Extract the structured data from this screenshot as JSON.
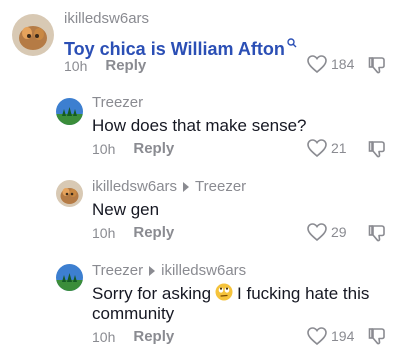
{
  "comments": [
    {
      "username": "ikilledsw6ars",
      "text": "Toy chica is William Afton",
      "time": "10h",
      "reply_label": "Reply",
      "likes": "184"
    },
    {
      "username": "Treezer",
      "text": "How does that make sense?",
      "time": "10h",
      "reply_label": "Reply",
      "likes": "21"
    },
    {
      "username": "ikilledsw6ars",
      "reply_to": "Treezer",
      "text": "New gen",
      "time": "10h",
      "reply_label": "Reply",
      "likes": "29"
    },
    {
      "username": "Treezer",
      "reply_to": "ikilledsw6ars",
      "text_part1": "Sorry for asking",
      "text_part2": "I fucking hate this",
      "text_line2": "community",
      "time": "10h",
      "reply_label": "Reply",
      "likes": "194"
    }
  ],
  "colors": {
    "link_text": "#2b4fb5",
    "muted": "#8a8b91",
    "primary_text": "#161823"
  },
  "icons": [
    "search-icon",
    "heart-icon",
    "dislike-icon",
    "reply-arrow-icon",
    "rolling-eyes-emoji"
  ]
}
